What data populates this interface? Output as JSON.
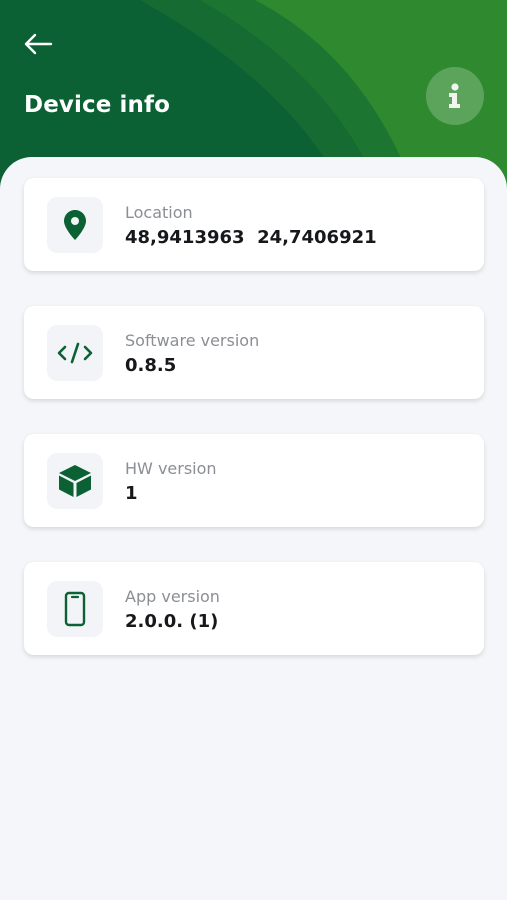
{
  "header": {
    "title": "Device info",
    "back_icon": "arrow-left-icon",
    "info_icon": "info-icon"
  },
  "colors": {
    "header_dark": "#0b6133",
    "header_mid": "#1a7530",
    "header_light": "#2f8a2f",
    "icon_green": "#0b6133",
    "background": "#f5f6fa"
  },
  "cards": [
    {
      "label": "Location",
      "value": "48,9413963  24,7406921",
      "icon": "location-pin-icon"
    },
    {
      "label": "Software version",
      "value": "0.8.5",
      "icon": "code-icon"
    },
    {
      "label": "HW version",
      "value": "1",
      "icon": "box-icon"
    },
    {
      "label": "App version",
      "value": "2.0.0. (1)",
      "icon": "smartphone-icon"
    }
  ]
}
